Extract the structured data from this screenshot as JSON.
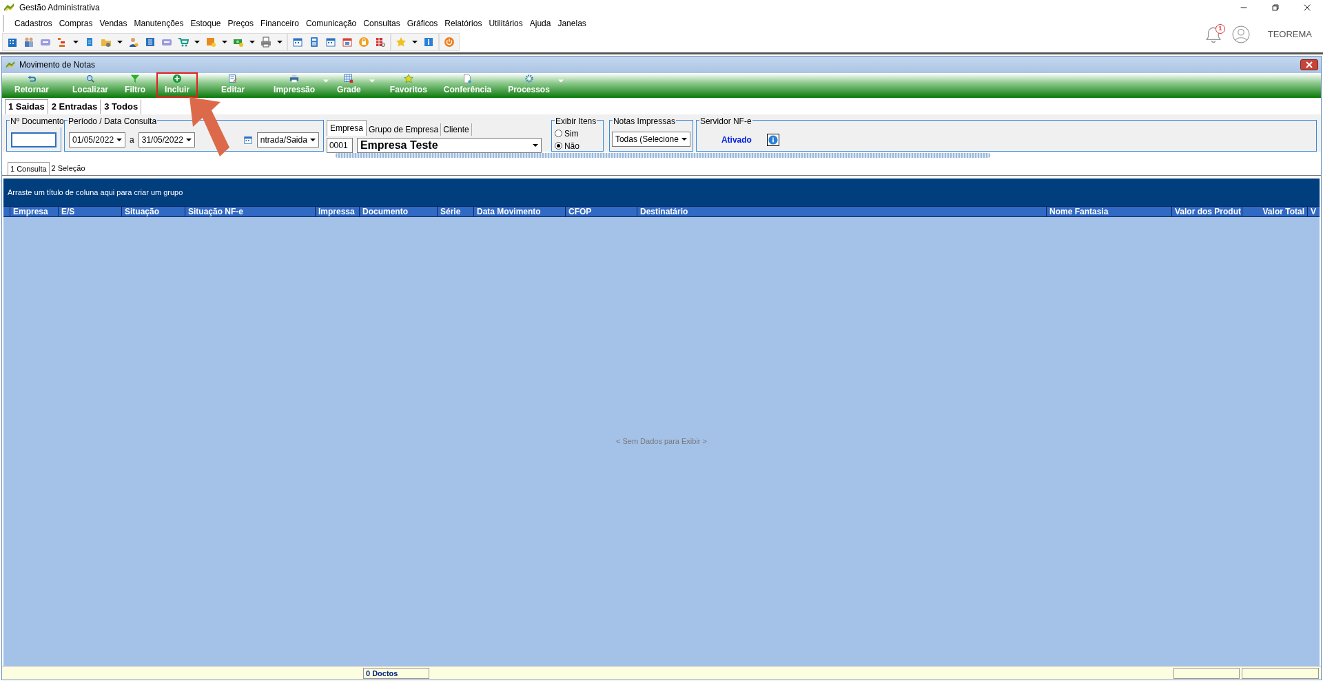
{
  "window": {
    "title": "Gestão Administrativa"
  },
  "menu": [
    "Cadastros",
    "Compras",
    "Vendas",
    "Manutenções",
    "Estoque",
    "Preços",
    "Financeiro",
    "Comunicação",
    "Consultas",
    "Gráficos",
    "Relatórios",
    "Utilitários",
    "Ajuda",
    "Janelas"
  ],
  "notifications": {
    "count": "1"
  },
  "user": "TEOREMA",
  "form": {
    "title": "Movimento de Notas",
    "actions": [
      {
        "label": "Retornar",
        "dropdown": false,
        "highlighted": false
      },
      {
        "label": "Localizar",
        "dropdown": false,
        "highlighted": false
      },
      {
        "label": "Filtro",
        "dropdown": false,
        "highlighted": false
      },
      {
        "label": "Incluir",
        "dropdown": false,
        "highlighted": true
      },
      {
        "label": "Editar",
        "dropdown": false,
        "highlighted": false
      },
      {
        "label": "Impressão",
        "dropdown": true,
        "highlighted": false
      },
      {
        "label": "Grade",
        "dropdown": true,
        "highlighted": false
      },
      {
        "label": "Favoritos",
        "dropdown": false,
        "highlighted": false
      },
      {
        "label": "Conferência",
        "dropdown": false,
        "highlighted": false
      },
      {
        "label": "Processos",
        "dropdown": true,
        "highlighted": false
      }
    ],
    "tabs": [
      {
        "label": "1 Saidas",
        "selected": true
      },
      {
        "label": "2 Entradas",
        "selected": false
      },
      {
        "label": "3 Todos",
        "selected": false
      }
    ],
    "doc_number": {
      "label": "Nº Documento"
    },
    "period": {
      "label": "Período / Data Consulta",
      "from": "01/05/2022",
      "separator": "a",
      "to": "31/05/2022",
      "type": "ntrada/Saida"
    },
    "company_tabs": [
      {
        "label": "Empresa",
        "selected": true
      },
      {
        "label": "Grupo de Empresa",
        "selected": false
      },
      {
        "label": "Cliente",
        "selected": false
      }
    ],
    "company_code": "0001",
    "company_name": "Empresa Teste",
    "show_items": {
      "label": "Exibir Itens",
      "options": [
        {
          "label": "Sim",
          "selected": false
        },
        {
          "label": "Não",
          "selected": true
        }
      ]
    },
    "printed_notes": {
      "label": "Notas Impressas",
      "value": "Todas (Selecione"
    },
    "nfe_server": {
      "label": "Servidor NF-e",
      "status": "Ativado"
    },
    "view_tabs": [
      {
        "label": "1 Consulta",
        "selected": true
      },
      {
        "label": "2 Seleção",
        "selected": false
      }
    ],
    "grid": {
      "group_hint": "Arraste um título de coluna aqui para criar um grupo",
      "columns": [
        "Empresa",
        "E/S",
        "Situação",
        "Situação NF-e",
        "Impressa",
        "Documento",
        "Série",
        "Data Movimento",
        "CFOP",
        "Destinatário",
        "Nome Fantasia",
        "Valor dos Produt",
        "Valor Total",
        "V"
      ],
      "empty_text": "< Sem Dados para Exibir >"
    },
    "status": "0 Doctos"
  },
  "annotation": {
    "kind": "arrow"
  }
}
